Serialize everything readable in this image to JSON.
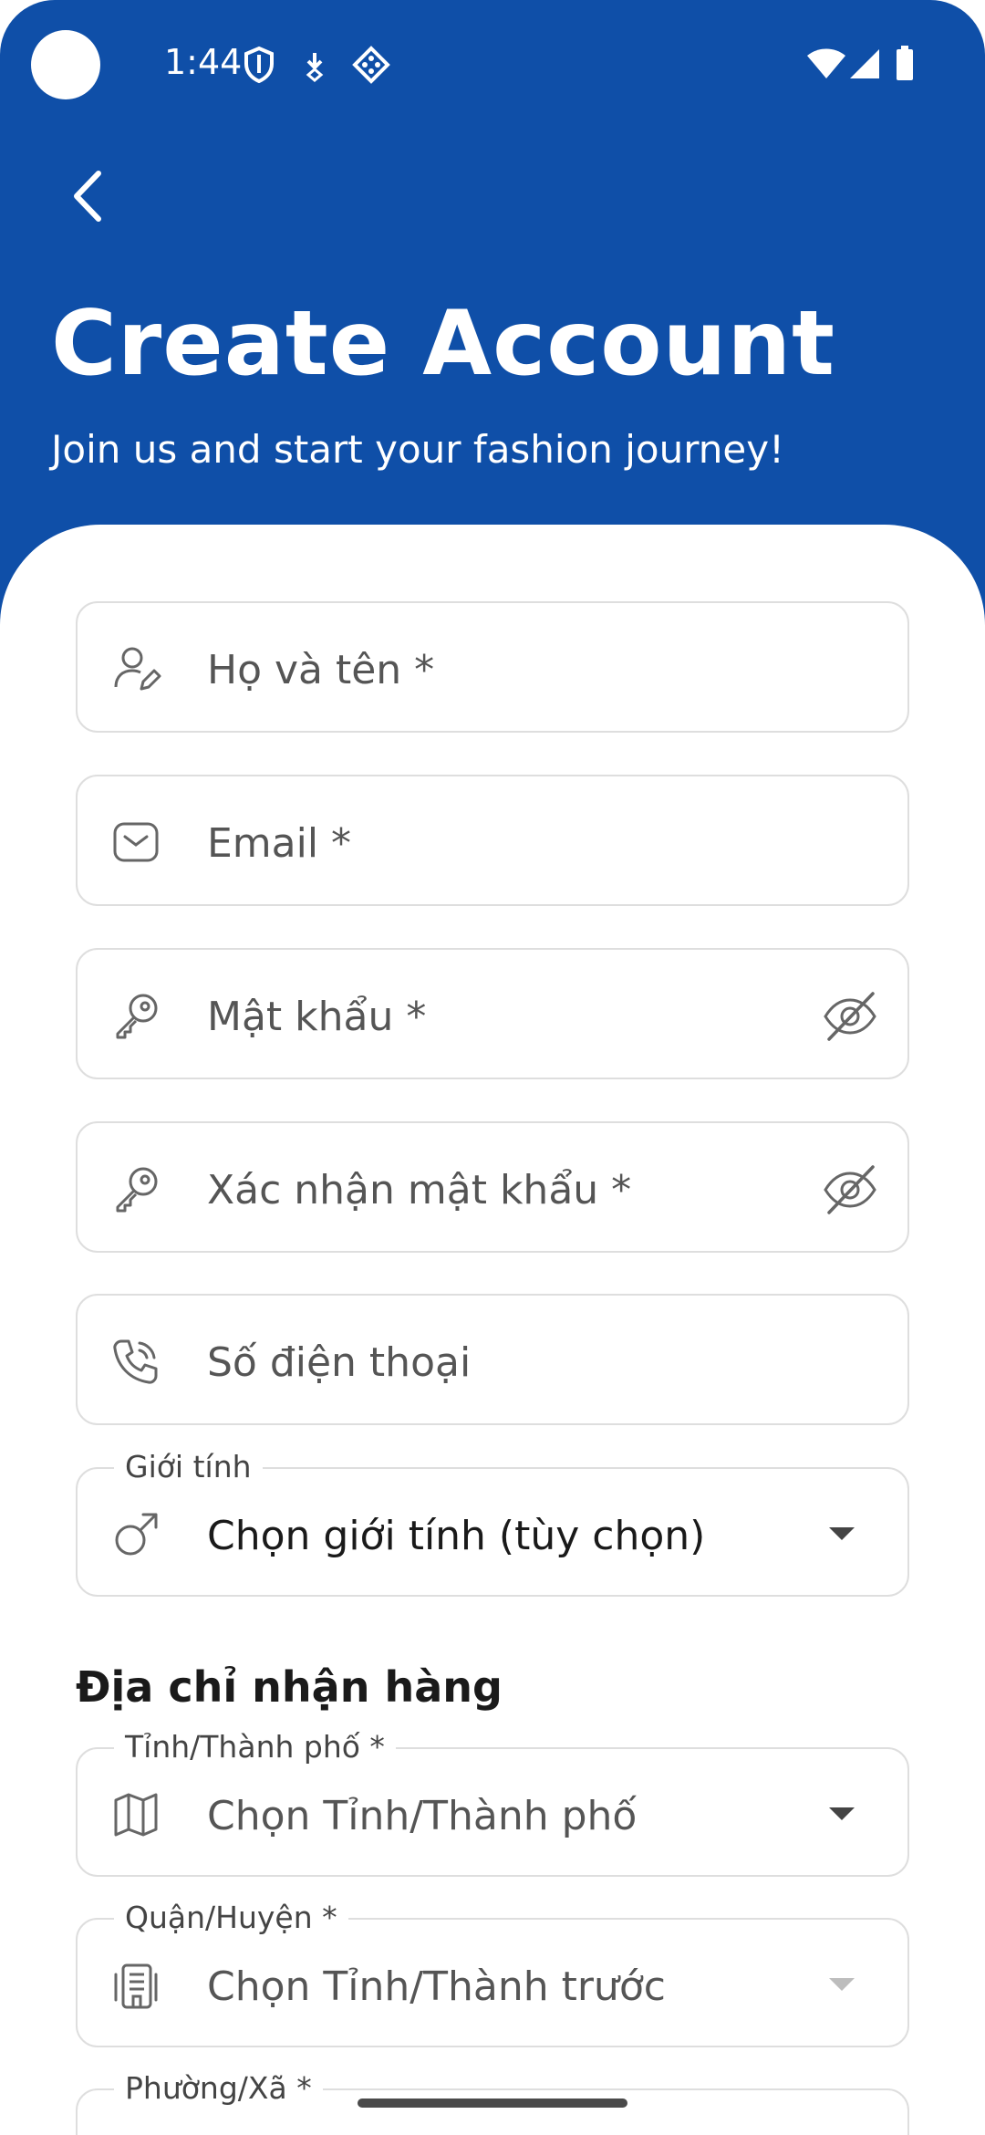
{
  "status_bar": {
    "time": "1:44"
  },
  "header": {
    "title": "Create Account",
    "subtitle": "Join us and start your fashion journey!"
  },
  "form": {
    "full_name": {
      "placeholder": "Họ và tên *",
      "icon": "user-edit-icon"
    },
    "email": {
      "placeholder": "Email *",
      "icon": "mail-icon"
    },
    "password": {
      "placeholder": "Mật khẩu *",
      "icon": "key-icon"
    },
    "confirm_password": {
      "placeholder": "Xác nhận mật khẩu *",
      "icon": "key-icon"
    },
    "phone": {
      "placeholder": "Số điện thoại",
      "icon": "phone-icon"
    },
    "gender": {
      "label": "Giới tính",
      "value": "Chọn giới tính (tùy chọn)",
      "icon": "male-icon"
    }
  },
  "address": {
    "section_title": "Địa chỉ nhận hàng",
    "province": {
      "label": "Tỉnh/Thành phố *",
      "value": "Chọn Tỉnh/Thành phố",
      "icon": "map-icon"
    },
    "district": {
      "label": "Quận/Huyện *",
      "value": "Chọn Tỉnh/Thành trước",
      "icon": "building-icon"
    },
    "ward": {
      "label": "Phường/Xã *"
    }
  },
  "colors": {
    "header_blue": "#0f4fa8",
    "border": "#dedede",
    "text_muted": "#555555"
  }
}
